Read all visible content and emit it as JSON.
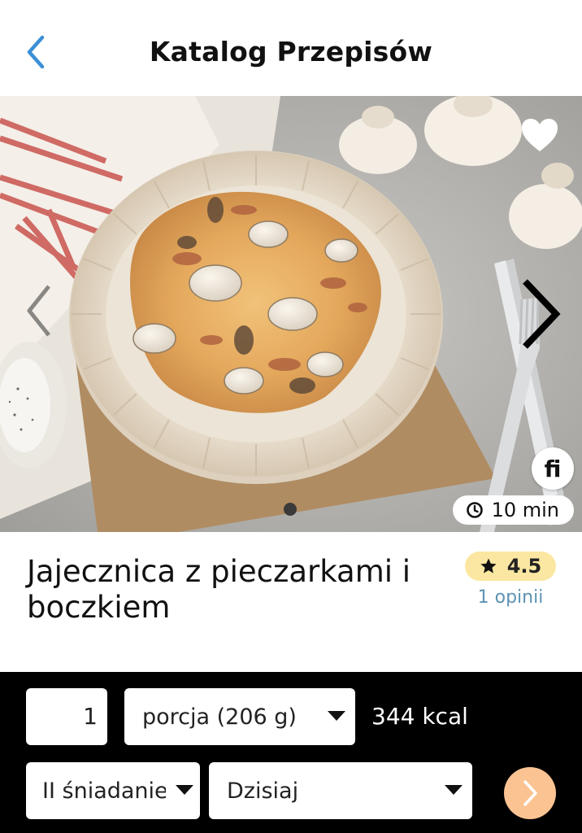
{
  "header": {
    "title": "Katalog Przepisów",
    "back_icon": "chevron-left-icon",
    "accent_color": "#3d8fd6"
  },
  "hero": {
    "favorite_icon": "heart-icon",
    "next_icon": "chevron-right-icon",
    "prev_icon": "chevron-left-icon",
    "brand_logo_text": "fi",
    "time_icon": "clock-icon",
    "time_label": "10 min",
    "carousel": {
      "current": 1,
      "total": 1
    }
  },
  "recipe": {
    "title": "Jajecznica z pieczarkami i boczkiem",
    "rating": "4.5",
    "rating_icon": "star-icon",
    "reviews_label": "1 opinii",
    "rating_badge_color": "#fbe7a1",
    "reviews_color": "#5d93b3"
  },
  "portion": {
    "quantity": "1",
    "unit_selected": "porcja (206 g)",
    "kcal_label": "344 kcal",
    "meal_selected": "II śniadanie",
    "day_selected": "Dzisiaj",
    "confirm_icon": "chevron-right-icon",
    "confirm_color": "#fbc392"
  }
}
